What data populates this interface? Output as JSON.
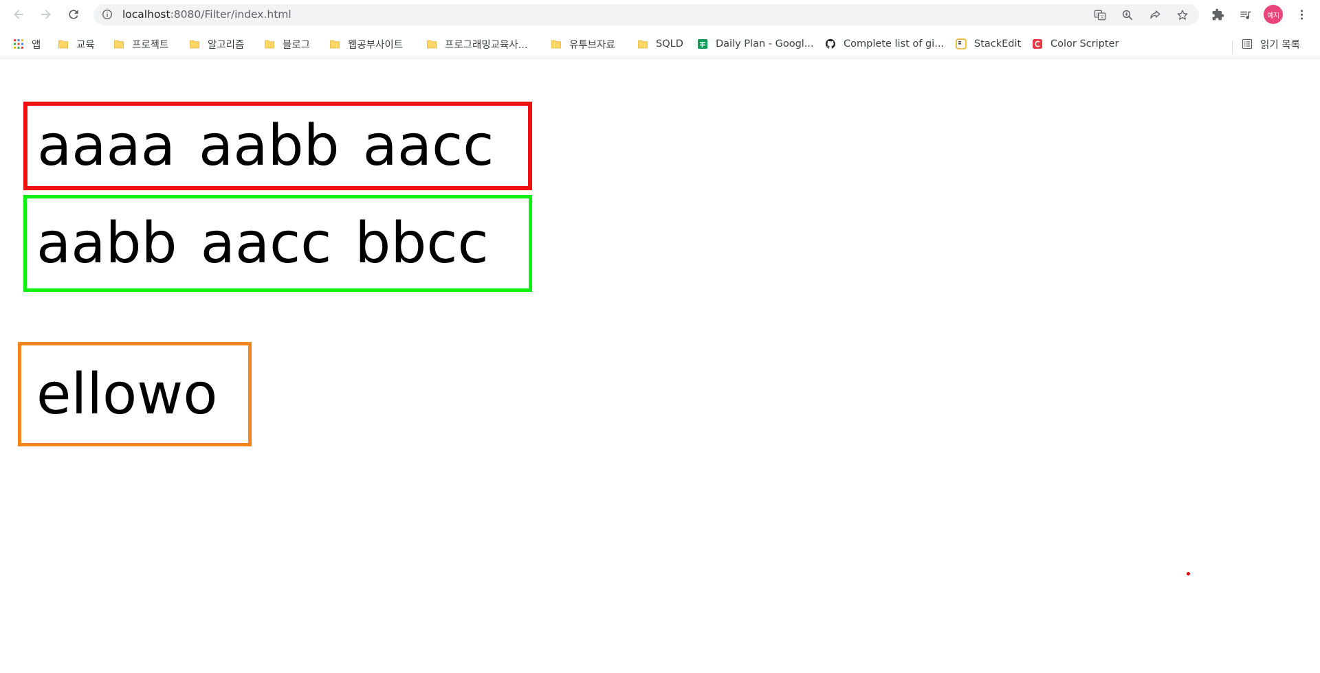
{
  "browser": {
    "url_host": "localhost",
    "url_path": ":8080/Filter/index.html",
    "profile_label": "예지"
  },
  "bookmarks": [
    {
      "label": "앱",
      "icon": "apps-grid-icon"
    },
    {
      "label": "교육",
      "icon": "folder-icon"
    },
    {
      "label": "프로젝트",
      "icon": "folder-icon"
    },
    {
      "label": "알고리즘",
      "icon": "folder-icon"
    },
    {
      "label": "블로그",
      "icon": "folder-icon"
    },
    {
      "label": "웹공부사이트",
      "icon": "folder-icon"
    },
    {
      "label": "프로그래밍교육사...",
      "icon": "folder-icon"
    },
    {
      "label": "유투브자료",
      "icon": "folder-icon"
    },
    {
      "label": "SQLD",
      "icon": "folder-icon"
    },
    {
      "label": "Daily Plan - Googl...",
      "icon": "google-sheets-icon"
    },
    {
      "label": "Complete list of gi...",
      "icon": "github-icon"
    },
    {
      "label": "StackEdit",
      "icon": "stackedit-icon"
    },
    {
      "label": "Color Scripter",
      "icon": "color-scripter-icon"
    }
  ],
  "reading_list": {
    "label": "읽기 목록",
    "icon": "reading-list-icon"
  },
  "page": {
    "red_box": {
      "words": [
        "aaaa",
        "aabb",
        "aacc"
      ],
      "border_color": "#ee1111"
    },
    "green_box": {
      "words": [
        "aabb",
        "aacc",
        "bbcc"
      ],
      "border_color": "#11ee11"
    },
    "orange_box": {
      "text": "ellowo",
      "border_color": "#f5841f"
    }
  },
  "colors": {
    "avatar": "#e8457a",
    "folder": "#fdd663",
    "dot": "#e10000"
  }
}
